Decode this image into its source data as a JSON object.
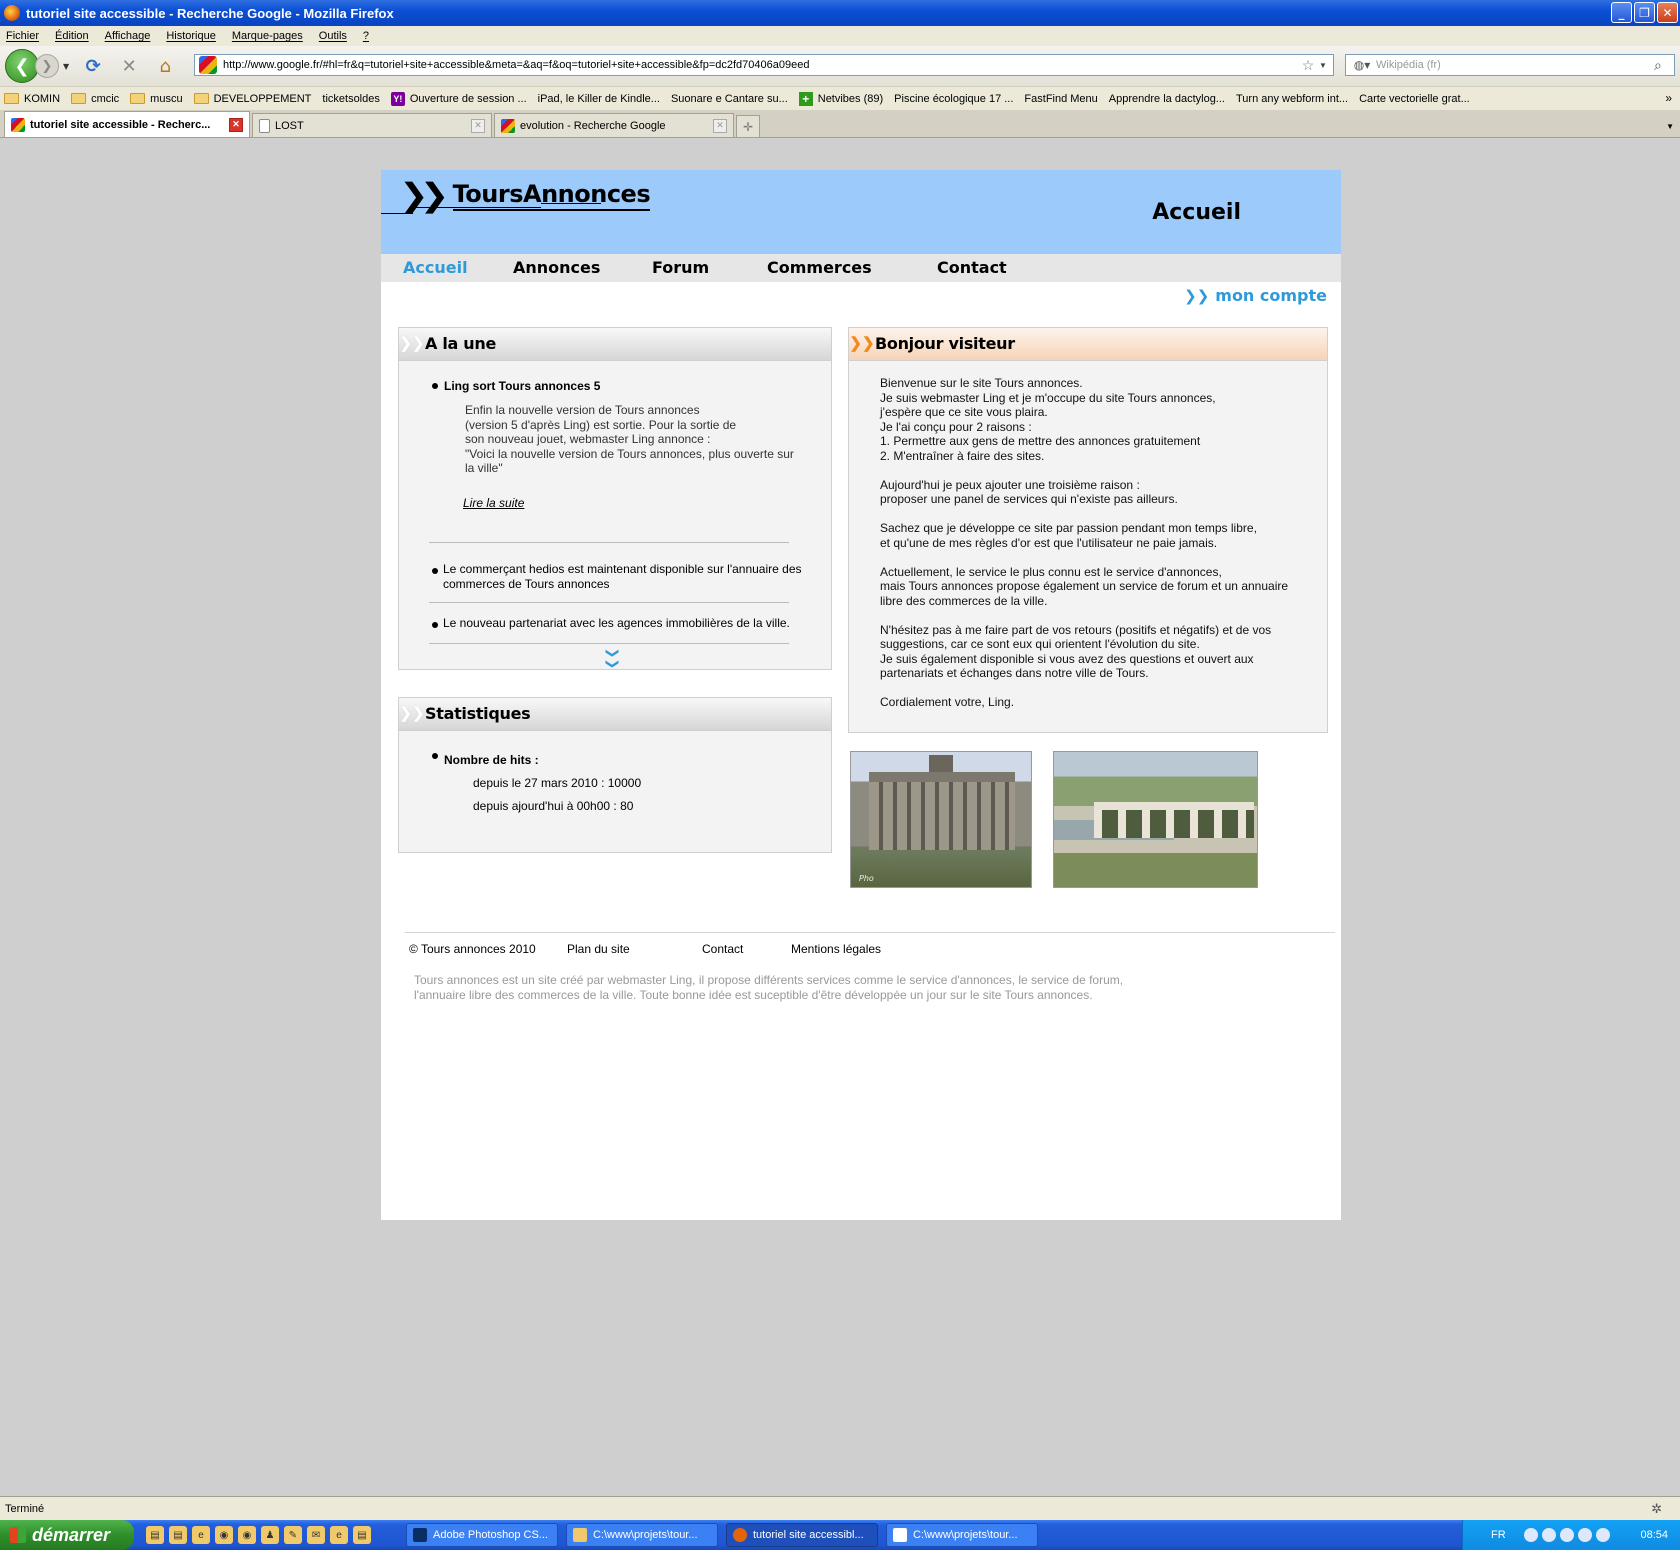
{
  "window": {
    "title": "tutoriel site accessible - Recherche Google - Mozilla Firefox",
    "buttons": [
      "_",
      "❐",
      "✕"
    ]
  },
  "menu": [
    "Fichier",
    "Édition",
    "Affichage",
    "Historique",
    "Marque-pages",
    "Outils",
    "?"
  ],
  "address": {
    "url": "http://www.google.fr/#hl=fr&q=tutoriel+site+accessible&meta=&aq=f&oq=tutoriel+site+accessible&fp=dc2fd70406a09eed"
  },
  "search": {
    "placeholder": "Wikipédia (fr)"
  },
  "bookmarks": [
    {
      "label": "KOMIN",
      "type": "folder"
    },
    {
      "label": "cmcic",
      "type": "folder"
    },
    {
      "label": "muscu",
      "type": "folder"
    },
    {
      "label": "DEVELOPPEMENT",
      "type": "folder"
    },
    {
      "label": "ticketsoldes",
      "type": "page"
    },
    {
      "label": "Ouverture de session ...",
      "type": "yahoo"
    },
    {
      "label": "iPad, le Killer de Kindle...",
      "type": "page"
    },
    {
      "label": "Suonare e Cantare su...",
      "type": "page"
    },
    {
      "label": "Netvibes (89)",
      "type": "plus"
    },
    {
      "label": "Piscine écologique 17 ...",
      "type": "page"
    },
    {
      "label": "FastFind Menu",
      "type": "page"
    },
    {
      "label": "Apprendre la dactylog...",
      "type": "page"
    },
    {
      "label": "Turn any webform int...",
      "type": "page"
    },
    {
      "label": "Carte vectorielle grat...",
      "type": "page"
    }
  ],
  "tabs": [
    {
      "label": "tutoriel site accessible - Recherc...",
      "icon": "google"
    },
    {
      "label": "LOST",
      "icon": "page"
    },
    {
      "label": "evolution - Recherche Google",
      "icon": "google"
    }
  ],
  "site": {
    "logo": "ToursAnnonces",
    "page_title": "Accueil",
    "nav": [
      "Accueil",
      "Annonces",
      "Forum",
      "Commerces",
      "Contact"
    ],
    "account": "mon compte",
    "colors": {
      "accent": "#2f9ad9",
      "header": "#9ccbfb",
      "orange": "#f28b1f"
    },
    "une": {
      "title": "A la une",
      "item1_title": "Ling sort Tours annonces 5",
      "item1_body": [
        "Enfin la nouvelle version de Tours annonces",
        " (version 5 d'après Ling) est sortie. Pour la sortie de",
        "son nouveau jouet, webmaster Ling annonce :",
        "\"Voici la nouvelle version de Tours annonces, plus ouverte sur",
        "la ville\""
      ],
      "read_more": "Lire la suite",
      "item2": "Le commerçant hedios est maintenant disponible sur l'annuaire des commerces de Tours annonces",
      "item3": "Le nouveau partenariat avec les agences immobilières de la ville."
    },
    "stats": {
      "title": "Statistiques",
      "label": "Nombre de hits :",
      "since_date": "depuis le 27 mars 2010 : 10000",
      "today": "depuis ajourd'hui à 00h00 : 80"
    },
    "welcome": {
      "title": "Bonjour visiteur",
      "paragraphs": [
        [
          "Bienvenue sur le site Tours annonces.",
          "Je suis webmaster Ling et je m'occupe du site Tours annonces,",
          "j'espère que ce site vous plaira.",
          "Je l'ai conçu pour 2 raisons :",
          "1. Permettre aux gens de mettre des annonces gratuitement",
          "2. M'entraîner à faire des sites."
        ],
        [
          "Aujourd'hui je peux ajouter une troisième raison :",
          "proposer une panel de services qui n'existe pas ailleurs."
        ],
        [
          "Sachez que je développe ce site par passion pendant mon temps libre,",
          "et qu'une de mes règles d'or est que l'utilisateur ne paie jamais."
        ],
        [
          "Actuellement, le service le plus connu est le service d'annonces,",
          "mais Tours annonces propose également un service de forum et un annuaire",
          "libre des commerces de la ville."
        ],
        [
          "N'hésitez pas à me faire part de vos retours (positifs et négatifs) et de vos",
          "suggestions, car ce sont eux qui orientent l'évolution du site.",
          "Je suis également disponible si vous avez des questions et ouvert aux",
          "partenariats et échanges dans notre ville de Tours."
        ],
        [
          "Cordialement votre, Ling."
        ]
      ]
    },
    "photo_tag": "Pho",
    "footer": {
      "copyright": "© Tours annonces 2010",
      "links": [
        "Plan du site",
        "Contact",
        "Mentions légales"
      ],
      "note": "Tours annonces est un site créé par webmaster Ling, il propose différents services comme le service d'annonces, le service de forum, l'annuaire libre des commerces de la ville. Toute bonne idée est suceptible d'être développée un jour sur le site Tours annonces."
    }
  },
  "status": "Terminé",
  "taskbar": {
    "start": "démarrer",
    "tasks": [
      {
        "label": "Adobe Photoshop CS...",
        "active": false
      },
      {
        "label": "C:\\www\\projets\\tour...",
        "active": false
      },
      {
        "label": "tutoriel site accessibl...",
        "active": true
      },
      {
        "label": "C:\\www\\projets\\tour...",
        "active": false
      }
    ],
    "lang": "FR",
    "clock": "08:54"
  }
}
